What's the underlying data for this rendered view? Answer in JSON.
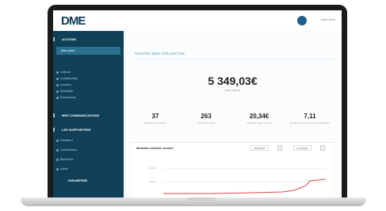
{
  "app": {
    "logo": "DME",
    "user_name": "Nom Nom"
  },
  "sidebar": {
    "section_actions": "Actions",
    "active_item": "Mes dons",
    "items": [
      "Collecte",
      "Crowdfunding",
      "Soutiens",
      "Newsletter",
      "Événements"
    ],
    "section_communication": "Mes communications",
    "section_supporters": "Les supporters",
    "subitems": [
      "Donateurs",
      "Contributeurs",
      "Bénévoles",
      "Autres"
    ],
    "footer_item": "Paramètres"
  },
  "main": {
    "page_title": "Toutes mes collectes",
    "total_amount": "5 349,03€",
    "total_label": "Total collecté",
    "stats": [
      {
        "value": "37",
        "label": "Nombre de donateurs"
      },
      {
        "value": "263",
        "label": "Nombre de dons"
      },
      {
        "value": "20,34€",
        "label": "Montant moyen du don"
      },
      {
        "value": "7,11",
        "label": "Nombre moyen de dons par donateur"
      }
    ],
    "chart_title": "Montant collecté cumulé",
    "date_from": "01/03/2021",
    "date_to": "31/03/2021",
    "y_ticks": [
      "4000,0",
      "2000,0"
    ]
  },
  "colors": {
    "sidebar": "#0f4058",
    "accent": "#3a8fb5",
    "line": "#e0454f"
  }
}
